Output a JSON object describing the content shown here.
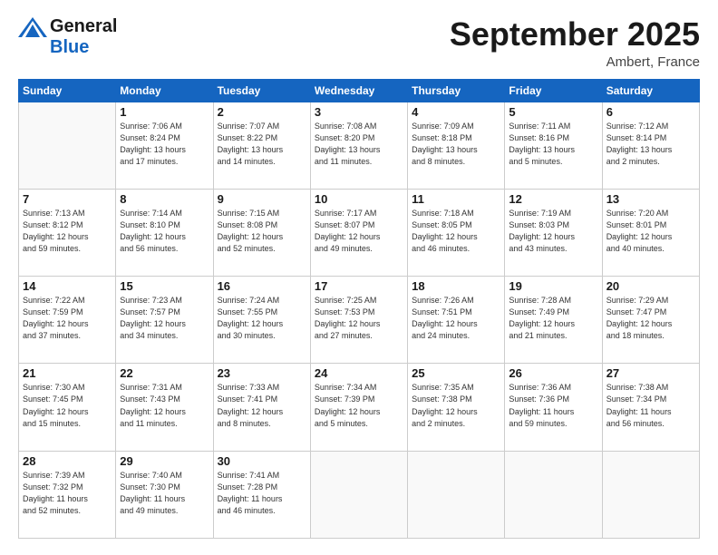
{
  "logo": {
    "general": "General",
    "blue": "Blue"
  },
  "header": {
    "month": "September 2025",
    "location": "Ambert, France"
  },
  "days_of_week": [
    "Sunday",
    "Monday",
    "Tuesday",
    "Wednesday",
    "Thursday",
    "Friday",
    "Saturday"
  ],
  "weeks": [
    [
      {
        "day": "",
        "info": ""
      },
      {
        "day": "1",
        "info": "Sunrise: 7:06 AM\nSunset: 8:24 PM\nDaylight: 13 hours\nand 17 minutes."
      },
      {
        "day": "2",
        "info": "Sunrise: 7:07 AM\nSunset: 8:22 PM\nDaylight: 13 hours\nand 14 minutes."
      },
      {
        "day": "3",
        "info": "Sunrise: 7:08 AM\nSunset: 8:20 PM\nDaylight: 13 hours\nand 11 minutes."
      },
      {
        "day": "4",
        "info": "Sunrise: 7:09 AM\nSunset: 8:18 PM\nDaylight: 13 hours\nand 8 minutes."
      },
      {
        "day": "5",
        "info": "Sunrise: 7:11 AM\nSunset: 8:16 PM\nDaylight: 13 hours\nand 5 minutes."
      },
      {
        "day": "6",
        "info": "Sunrise: 7:12 AM\nSunset: 8:14 PM\nDaylight: 13 hours\nand 2 minutes."
      }
    ],
    [
      {
        "day": "7",
        "info": "Sunrise: 7:13 AM\nSunset: 8:12 PM\nDaylight: 12 hours\nand 59 minutes."
      },
      {
        "day": "8",
        "info": "Sunrise: 7:14 AM\nSunset: 8:10 PM\nDaylight: 12 hours\nand 56 minutes."
      },
      {
        "day": "9",
        "info": "Sunrise: 7:15 AM\nSunset: 8:08 PM\nDaylight: 12 hours\nand 52 minutes."
      },
      {
        "day": "10",
        "info": "Sunrise: 7:17 AM\nSunset: 8:07 PM\nDaylight: 12 hours\nand 49 minutes."
      },
      {
        "day": "11",
        "info": "Sunrise: 7:18 AM\nSunset: 8:05 PM\nDaylight: 12 hours\nand 46 minutes."
      },
      {
        "day": "12",
        "info": "Sunrise: 7:19 AM\nSunset: 8:03 PM\nDaylight: 12 hours\nand 43 minutes."
      },
      {
        "day": "13",
        "info": "Sunrise: 7:20 AM\nSunset: 8:01 PM\nDaylight: 12 hours\nand 40 minutes."
      }
    ],
    [
      {
        "day": "14",
        "info": "Sunrise: 7:22 AM\nSunset: 7:59 PM\nDaylight: 12 hours\nand 37 minutes."
      },
      {
        "day": "15",
        "info": "Sunrise: 7:23 AM\nSunset: 7:57 PM\nDaylight: 12 hours\nand 34 minutes."
      },
      {
        "day": "16",
        "info": "Sunrise: 7:24 AM\nSunset: 7:55 PM\nDaylight: 12 hours\nand 30 minutes."
      },
      {
        "day": "17",
        "info": "Sunrise: 7:25 AM\nSunset: 7:53 PM\nDaylight: 12 hours\nand 27 minutes."
      },
      {
        "day": "18",
        "info": "Sunrise: 7:26 AM\nSunset: 7:51 PM\nDaylight: 12 hours\nand 24 minutes."
      },
      {
        "day": "19",
        "info": "Sunrise: 7:28 AM\nSunset: 7:49 PM\nDaylight: 12 hours\nand 21 minutes."
      },
      {
        "day": "20",
        "info": "Sunrise: 7:29 AM\nSunset: 7:47 PM\nDaylight: 12 hours\nand 18 minutes."
      }
    ],
    [
      {
        "day": "21",
        "info": "Sunrise: 7:30 AM\nSunset: 7:45 PM\nDaylight: 12 hours\nand 15 minutes."
      },
      {
        "day": "22",
        "info": "Sunrise: 7:31 AM\nSunset: 7:43 PM\nDaylight: 12 hours\nand 11 minutes."
      },
      {
        "day": "23",
        "info": "Sunrise: 7:33 AM\nSunset: 7:41 PM\nDaylight: 12 hours\nand 8 minutes."
      },
      {
        "day": "24",
        "info": "Sunrise: 7:34 AM\nSunset: 7:39 PM\nDaylight: 12 hours\nand 5 minutes."
      },
      {
        "day": "25",
        "info": "Sunrise: 7:35 AM\nSunset: 7:38 PM\nDaylight: 12 hours\nand 2 minutes."
      },
      {
        "day": "26",
        "info": "Sunrise: 7:36 AM\nSunset: 7:36 PM\nDaylight: 11 hours\nand 59 minutes."
      },
      {
        "day": "27",
        "info": "Sunrise: 7:38 AM\nSunset: 7:34 PM\nDaylight: 11 hours\nand 56 minutes."
      }
    ],
    [
      {
        "day": "28",
        "info": "Sunrise: 7:39 AM\nSunset: 7:32 PM\nDaylight: 11 hours\nand 52 minutes."
      },
      {
        "day": "29",
        "info": "Sunrise: 7:40 AM\nSunset: 7:30 PM\nDaylight: 11 hours\nand 49 minutes."
      },
      {
        "day": "30",
        "info": "Sunrise: 7:41 AM\nSunset: 7:28 PM\nDaylight: 11 hours\nand 46 minutes."
      },
      {
        "day": "",
        "info": ""
      },
      {
        "day": "",
        "info": ""
      },
      {
        "day": "",
        "info": ""
      },
      {
        "day": "",
        "info": ""
      }
    ]
  ]
}
